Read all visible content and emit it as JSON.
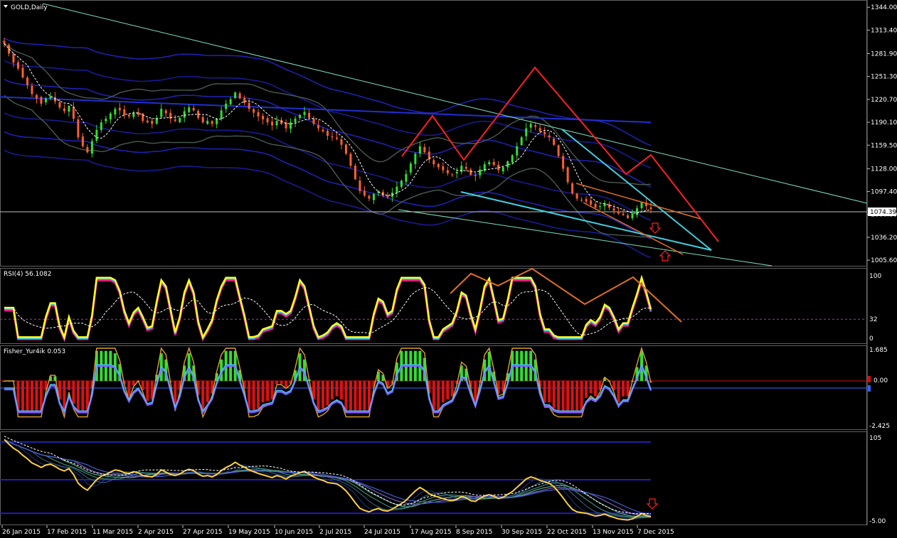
{
  "window": {
    "title": "GOLD,Daily"
  },
  "chart_data": [
    {
      "type": "candlestick",
      "panel": "price",
      "title": "GOLD,Daily",
      "y_ticks": [
        "1344.00",
        "1313.40",
        "1281.90",
        "1251.30",
        "1220.70",
        "1190.10",
        "1159.50",
        "1128.00",
        "1097.40",
        "1066.80",
        "1036.20",
        "1005.60"
      ],
      "ylim": [
        1000,
        1348
      ],
      "current_price": "1074.39",
      "x_ticks": [
        "26 Jan 2015",
        "17 Feb 2015",
        "11 Mar 2015",
        "2 Apr 2015",
        "27 Apr 2015",
        "19 May 2015",
        "10 Jun 2015",
        "2 Jul 2015",
        "24 Jul 2015",
        "17 Aug 2015",
        "8 Sep 2015",
        "30 Sep 2015",
        "22 Oct 2015",
        "13 Nov 2015",
        "7 Dec 2015"
      ],
      "close_path": [
        1295,
        1282,
        1270,
        1262,
        1250,
        1240,
        1228,
        1222,
        1215,
        1222,
        1225,
        1218,
        1210,
        1205,
        1212,
        1195,
        1170,
        1158,
        1150,
        1165,
        1180,
        1190,
        1195,
        1202,
        1208,
        1206,
        1200,
        1198,
        1203,
        1200,
        1192,
        1190,
        1188,
        1196,
        1208,
        1202,
        1195,
        1192,
        1196,
        1205,
        1210,
        1206,
        1196,
        1190,
        1192,
        1188,
        1195,
        1206,
        1215,
        1221,
        1230,
        1222,
        1216,
        1208,
        1203,
        1198,
        1194,
        1190,
        1186,
        1192,
        1188,
        1182,
        1190,
        1195,
        1200,
        1204,
        1196,
        1188,
        1182,
        1178,
        1172,
        1170,
        1168,
        1160,
        1148,
        1132,
        1114,
        1098,
        1092,
        1088,
        1094,
        1098,
        1092,
        1090,
        1096,
        1104,
        1112,
        1121,
        1135,
        1148,
        1158,
        1150,
        1140,
        1134,
        1130,
        1126,
        1122,
        1120,
        1124,
        1132,
        1128,
        1120,
        1118,
        1127,
        1134,
        1137,
        1133,
        1126,
        1130,
        1138,
        1146,
        1158,
        1170,
        1182,
        1188,
        1184,
        1178,
        1174,
        1170,
        1160,
        1145,
        1128,
        1110,
        1095,
        1088,
        1086,
        1084,
        1080,
        1076,
        1078,
        1082,
        1076,
        1072,
        1068,
        1066,
        1062,
        1068,
        1075,
        1083,
        1078,
        1074
      ],
      "series": [
        {
          "name": "RSI(4)",
          "value": "56.1082",
          "y_ticks": [
            "100",
            "32",
            "0"
          ]
        },
        {
          "name": "Fisher_Yur4ik",
          "value": "0.053",
          "y_ticks": [
            "1.685",
            "0.00",
            "-2.425"
          ]
        },
        {
          "name": "",
          "y_ticks": [
            "105",
            "-5.00"
          ]
        }
      ]
    }
  ]
}
